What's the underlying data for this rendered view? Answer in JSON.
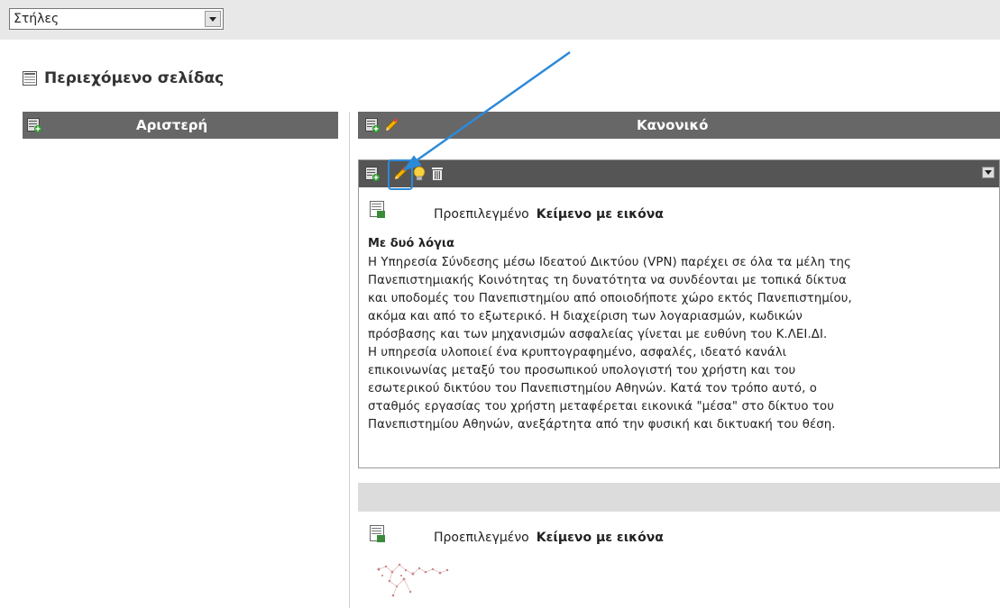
{
  "toolbar": {
    "select_value": "Στήλες"
  },
  "page": {
    "title": "Περιεχόμενο σελίδας"
  },
  "columns": {
    "left": "Αριστερή",
    "main": "Κανονικό"
  },
  "content_element_1": {
    "type_prefix": "Προεπιλεγμένο",
    "type_name": "Κείμενο με εικόνα",
    "header": "Με δυό λόγια",
    "lines": [
      "Η Υπηρεσία Σύνδεσης μέσω Ιδεατού Δικτύου (VPN) παρέχει σε όλα τα μέλη της",
      "Πανεπιστημιακής Κοινότητας τη δυνατότητα να συνδέονται με τοπικά δίκτυα",
      "και υποδομές του Πανεπιστημίου από οποιοδήποτε χώρο εκτός Πανεπιστημίου,",
      "ακόμα και από το εξωτερικό. Η διαχείριση των λογαριασμών, κωδικών",
      "πρόσβασης και των μηχανισμών ασφαλείας γίνεται με ευθύνη του Κ.ΛΕΙ.ΔΙ.",
      "Η υπηρεσία υλοποιεί ένα κρυπτογραφημένο, ασφαλές, ιδεατό κανάλι",
      "επικοινωνίας μεταξύ του προσωπικού υπολογιστή του χρήστη και του",
      "εσωτερικού δικτύου του Πανεπιστημίου Αθηνών. Κατά τον τρόπο αυτό, ο",
      "σταθμός εργασίας του χρήστη μεταφέρεται εικονικά \"μέσα\" στο δίκτυο του",
      "Πανεπιστημίου Αθηνών, ανεξάρτητα από την φυσική και δικτυακή του θέση."
    ]
  },
  "content_element_2": {
    "type_prefix": "Προεπιλεγμένο",
    "type_name": "Κείμενο με εικόνα"
  },
  "colors": {
    "bar": "#676767",
    "accent_arrow": "#2d8ad8"
  },
  "icons": [
    "new-content-icon",
    "edit-pencil-icon",
    "hide-lightbulb-icon",
    "delete-trash-icon",
    "collapse-icon",
    "page-icon",
    "content-type-icon"
  ]
}
